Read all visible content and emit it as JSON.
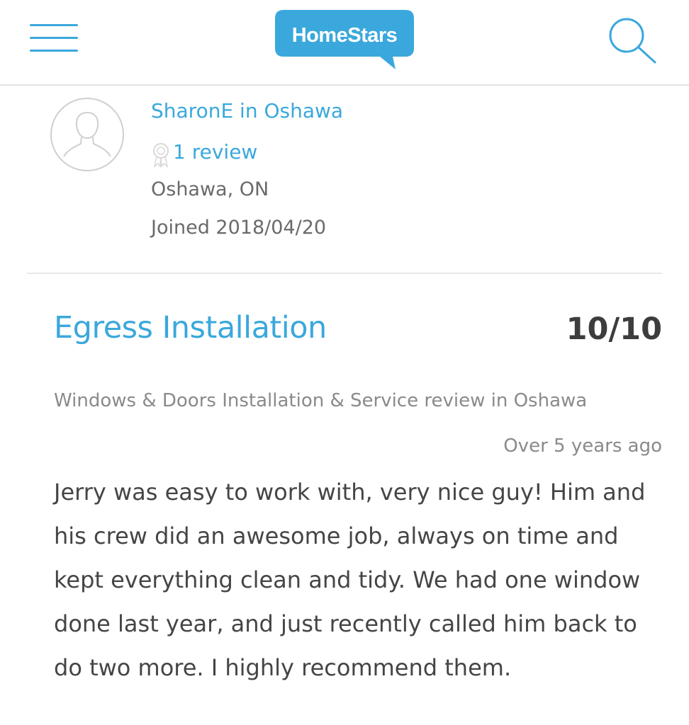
{
  "header": {
    "logo_text": "HomeStars",
    "menu_icon": "hamburger-menu-icon",
    "search_icon": "search-icon",
    "accent_color": "#3aa8dc"
  },
  "reviewer": {
    "avatar_icon": "user-silhouette-icon",
    "name": "SharonE in Oshawa",
    "review_count": "1 review",
    "badge_icon": "award-ribbon-icon",
    "location": "Oshawa, ON",
    "joined": "Joined 2018/04/20"
  },
  "review": {
    "title": "Egress Installation",
    "score": "10/10",
    "category": "Windows & Doors Installation & Service review in Oshawa",
    "time_ago": "Over 5 years ago",
    "body": "Jerry was easy to work with, very nice guy! Him and his crew did an awesome job, always on time and kept everything clean and tidy. We had one window done last year, and just recently called him back to do two more. I highly recommend them."
  }
}
